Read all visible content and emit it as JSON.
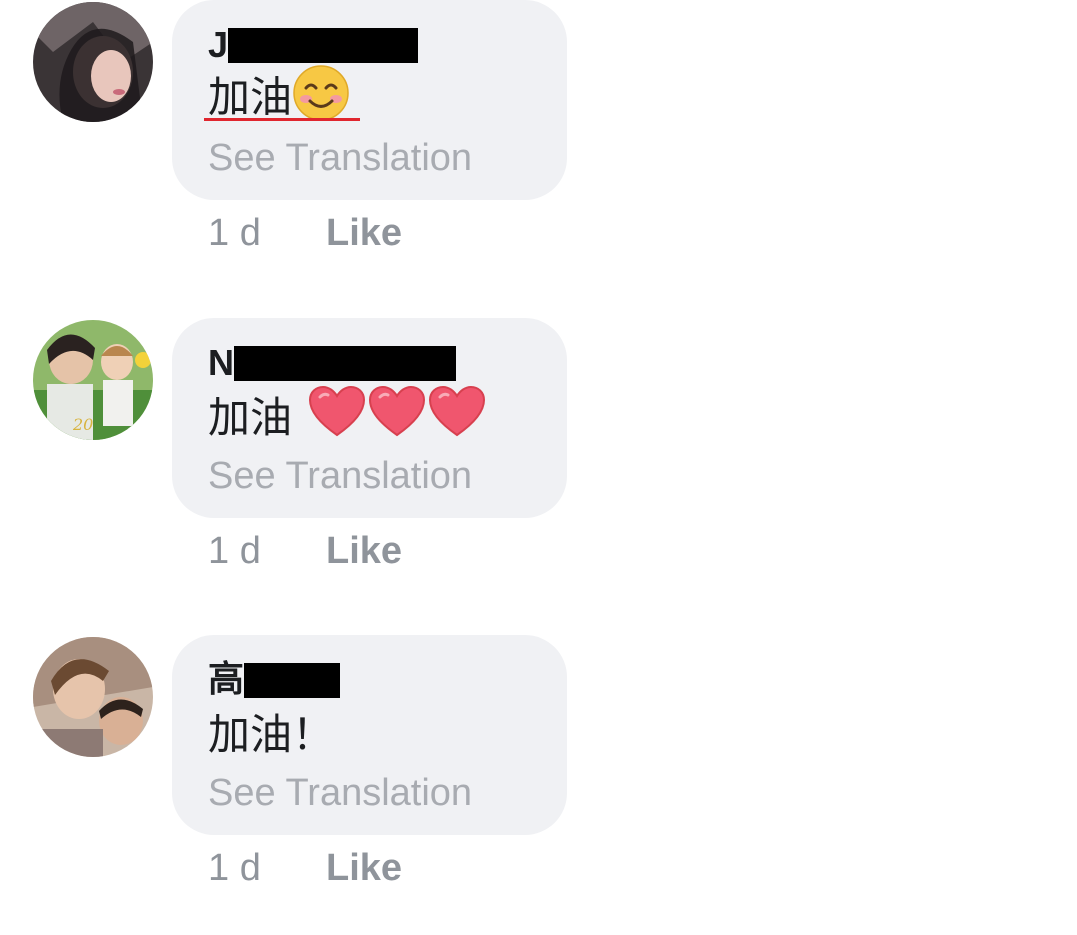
{
  "comments": [
    {
      "author_initial": "J",
      "text": "加油",
      "see_translation": "See Translation",
      "time": "1 d",
      "like": "Like",
      "reaction_icon": "smiling-face-emoji-icon"
    },
    {
      "author_initial": "N",
      "text": "加油",
      "see_translation": "See Translation",
      "time": "1 d",
      "like": "Like",
      "reaction_icon": "heart-emoji-icon"
    },
    {
      "author_initial": "高",
      "text": "加油！",
      "see_translation": "See Translation",
      "time": "1 d",
      "like": "Like",
      "reaction_icon": ""
    }
  ],
  "colors": {
    "bubble": "#f0f1f4",
    "name": "#1c1e21",
    "muted": "#8f949b",
    "translation": "#a8abb1",
    "heart": "#f0566e",
    "spellcheck": "#e0262e"
  }
}
